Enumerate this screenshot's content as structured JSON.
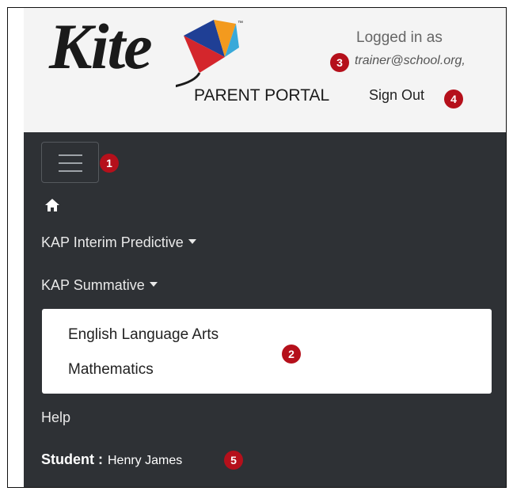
{
  "header": {
    "logo_text": "Kite",
    "portal_label": "PARENT PORTAL",
    "trademark": "™",
    "login_label": "Logged in as",
    "user_email": "trainer@school.org,",
    "sign_out": "Sign Out"
  },
  "nav": {
    "menu_toggle_icon": "hamburger-icon",
    "home_icon": "home-icon",
    "items": [
      {
        "label": "KAP Interim Predictive",
        "has_dropdown": true
      },
      {
        "label": "KAP Summative",
        "has_dropdown": true
      }
    ],
    "dropdown_items": [
      "English Language Arts",
      "Mathematics"
    ],
    "help": "Help",
    "student_label": "Student :",
    "student_name": "Henry James"
  },
  "callouts": [
    "1",
    "2",
    "3",
    "4",
    "5"
  ],
  "colors": {
    "nav_bg": "#2e3135",
    "header_bg": "#f4f4f4",
    "callout": "#b5101b",
    "kite_red": "#d4262c",
    "kite_blue": "#1f3f95",
    "kite_orange": "#f39a1e",
    "kite_cyan": "#39a9d9"
  }
}
